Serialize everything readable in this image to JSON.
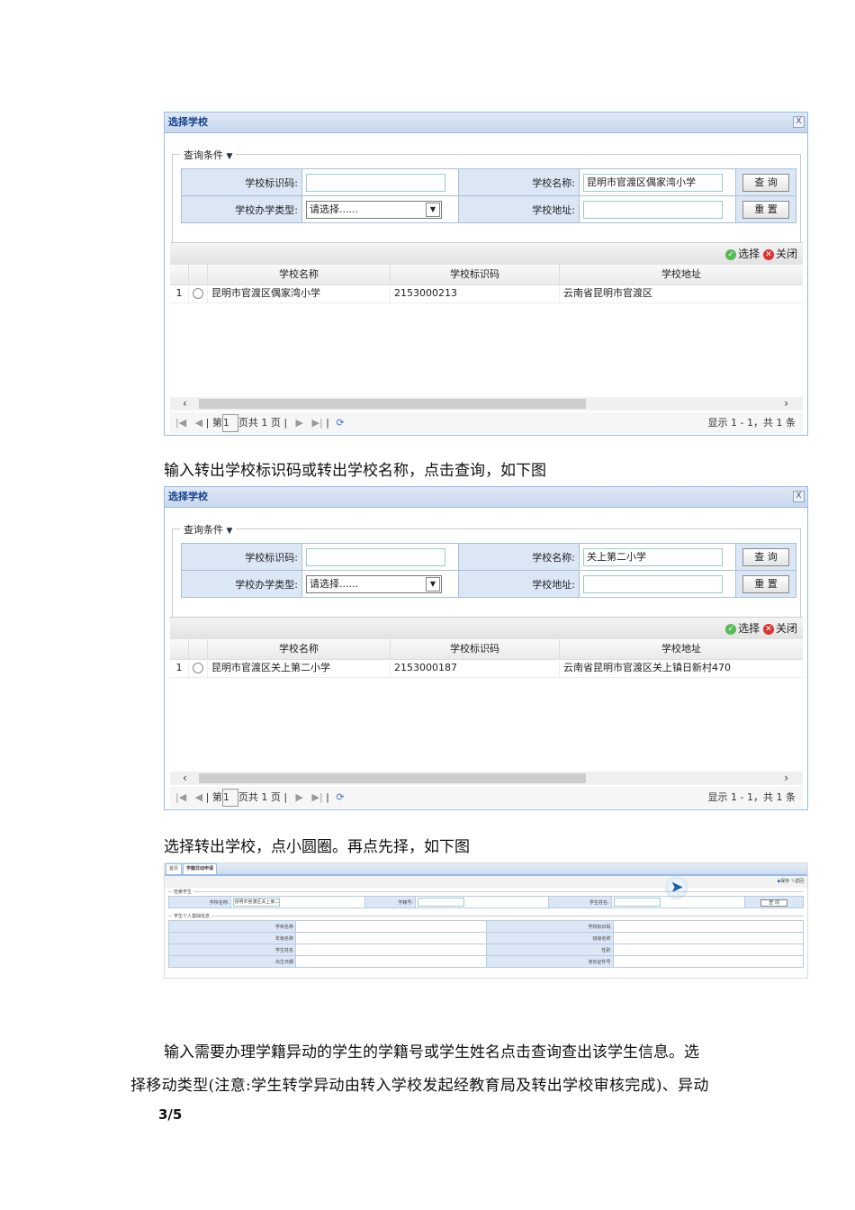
{
  "dialogs": [
    {
      "title": "选择学校",
      "close": "X",
      "legend": "查询条件",
      "labels": {
        "code": "学校标识码:",
        "name": "学校名称:",
        "type": "学校办学类型:",
        "addr": "学校地址:"
      },
      "values": {
        "code": "",
        "name": "昆明市官渡区偶家湾小学",
        "type": "请选择......",
        "addr": ""
      },
      "buttons": {
        "query": "查 询",
        "reset": "重 置",
        "select": "选择",
        "close": "关闭"
      },
      "columns": [
        "学校名称",
        "学校标识码",
        "学校地址"
      ],
      "rows": [
        {
          "no": "1",
          "name": "昆明市官渡区偶家湾小学",
          "code": "2153000213",
          "addr": "云南省昆明市官渡区"
        }
      ],
      "pager": {
        "page_prefix": "第",
        "page": "1",
        "page_suffix": "页共 1 页",
        "summary": "显示 1 - 1，共 1 条"
      }
    },
    {
      "title": "选择学校",
      "close": "X",
      "legend": "查询条件",
      "labels": {
        "code": "学校标识码:",
        "name": "学校名称:",
        "type": "学校办学类型:",
        "addr": "学校地址:"
      },
      "values": {
        "code": "",
        "name": "关上第二小学",
        "type": "请选择......",
        "addr": ""
      },
      "buttons": {
        "query": "查 询",
        "reset": "重 置",
        "select": "选择",
        "close": "关闭"
      },
      "columns": [
        "学校名称",
        "学校标识码",
        "学校地址"
      ],
      "rows": [
        {
          "no": "1",
          "name": "昆明市官渡区关上第二小学",
          "code": "2153000187",
          "addr": "云南省昆明市官渡区关上镇日新村470"
        }
      ],
      "pager": {
        "page_prefix": "第",
        "page": "1",
        "page_suffix": "页共 1 页",
        "summary": "显示 1 - 1，共 1 条"
      }
    }
  ],
  "text1": "输入转出学校标识码或转出学校名称，点击查询，如下图",
  "text2": "选择转出学校，点小圆圈。再点先择，如下图",
  "shot3": {
    "tabs": [
      "首页",
      "学籍异动申请"
    ],
    "save": "保存",
    "back": "返回",
    "search_legend": "检索学生",
    "school_label": "学校名称:",
    "school_value": "昆明市官渡区关上第二",
    "sid_label": "学籍号:",
    "sname_label": "学生姓名:",
    "query": "查 询",
    "info_legend": "学生个人基础信息",
    "info": [
      [
        "学校名称",
        "学校标识码"
      ],
      [
        "年级名称",
        "班级名称"
      ],
      [
        "学生姓名",
        "性别"
      ],
      [
        "出生日期",
        "身份证件号"
      ]
    ]
  },
  "para_line1": "输入需要办理学籍异动的学生的学籍号或学生姓名点击查询查出该学生信息。选",
  "para_line2": "择移动类型(注意:学生转学异动由转入学校发起经教育局及转出学校审核完成)、异动",
  "page_number": "3/5"
}
